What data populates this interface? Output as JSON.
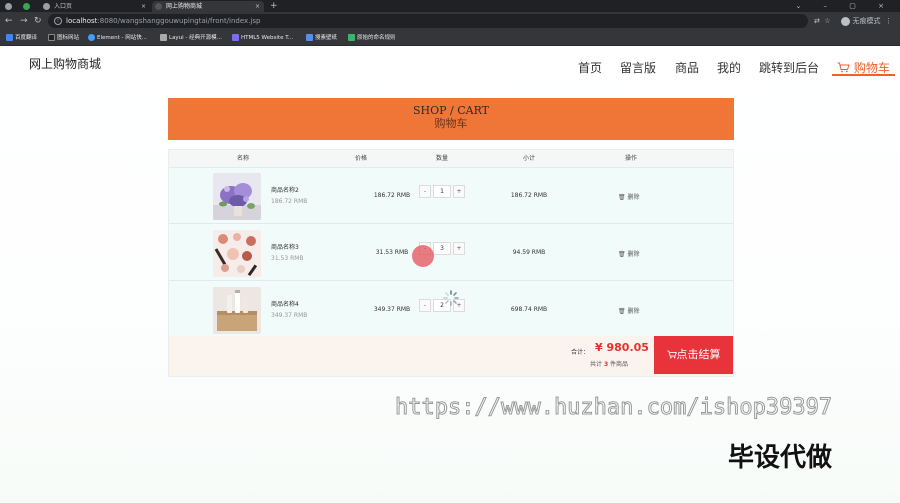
{
  "browser": {
    "tabs": [
      {
        "label": ""
      },
      {
        "label": ""
      },
      {
        "label": "入口页"
      },
      {
        "label": "网上购物商城"
      }
    ],
    "url_host": "localhost",
    "url_rest": ":8080/wangshanggouwupingtai/front/index.jsp",
    "profile_label": "无痕模式",
    "bookmarks": [
      "百度翻译",
      "图标网站",
      "Element - 网站快...",
      "Layui - 经典开源模...",
      "HTML5 Website T...",
      "搜素壁纸",
      "原始的命名规则"
    ]
  },
  "header": {
    "logo": "网上购物商城",
    "nav": [
      "首页",
      "留言版",
      "商品",
      "我的",
      "跳转到后台"
    ],
    "cart_label": "购物车"
  },
  "banner": {
    "title_en": "SHOP / CART",
    "title_zh": "购物车"
  },
  "table": {
    "columns": [
      "名称",
      "价格",
      "数量",
      "小计",
      "操作"
    ],
    "rows": [
      {
        "name": "商品名称2",
        "unit_price": "186.72 RMB",
        "price": "186.72 RMB",
        "qty": "1",
        "subtotal": "186.72 RMB",
        "delete_label": "删除",
        "image": "lavender-flowers"
      },
      {
        "name": "商品名称3",
        "unit_price": "31.53 RMB",
        "price": "31.53 RMB",
        "qty": "3",
        "subtotal": "94.59 RMB",
        "delete_label": "删除",
        "image": "cosmetics"
      },
      {
        "name": "商品名称4",
        "unit_price": "349.37 RMB",
        "price": "349.37 RMB",
        "qty": "2",
        "subtotal": "698.74 RMB",
        "delete_label": "删除",
        "image": "gift-box"
      }
    ],
    "minus": "-",
    "plus": "+"
  },
  "summary": {
    "total_label": "合计：",
    "total_value": "¥ 980.05",
    "count_prefix": "共计",
    "count_value": "3",
    "count_suffix": "件商品",
    "checkout_label": "点击结算"
  },
  "overlay": {
    "watermark": "https://www.huzhan.com/ishop39397",
    "stamp": "毕设代做"
  },
  "colors": {
    "accent": "#f07638",
    "cart_text": "#f0602a",
    "checkout": "#e8333a",
    "price_red": "#e4322d"
  }
}
